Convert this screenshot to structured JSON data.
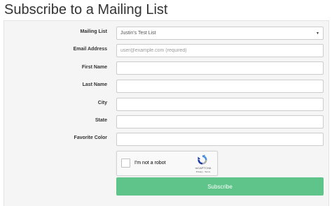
{
  "page": {
    "title": "Subscribe to a Mailing List"
  },
  "form": {
    "fields": [
      {
        "label": "Mailing List",
        "type": "select",
        "value": "Justin's Test List"
      },
      {
        "label": "Email Address",
        "type": "input",
        "value": "",
        "placeholder": "user@example.com (required)"
      },
      {
        "label": "First Name",
        "type": "input",
        "value": "",
        "placeholder": ""
      },
      {
        "label": "Last Name",
        "type": "input",
        "value": "",
        "placeholder": ""
      },
      {
        "label": "City",
        "type": "input",
        "value": "",
        "placeholder": ""
      },
      {
        "label": "State",
        "type": "input",
        "value": "",
        "placeholder": ""
      },
      {
        "label": "Favorite Color",
        "type": "input",
        "value": "",
        "placeholder": ""
      }
    ],
    "captcha": {
      "label": "I'm not a robot",
      "brand": "reCAPTCHA",
      "links": "Privacy - Terms",
      "checked": false
    },
    "submit_label": "Subscribe"
  },
  "colors": {
    "submit_button": "#5fc48a",
    "panel_background": "#f5f5f5",
    "captcha_logo_blue": "#4a90e2",
    "captcha_logo_gray": "#b0b0b0"
  },
  "icons": {
    "select_arrow": "caret-down-icon",
    "captcha_logo": "recaptcha-logo-icon"
  }
}
